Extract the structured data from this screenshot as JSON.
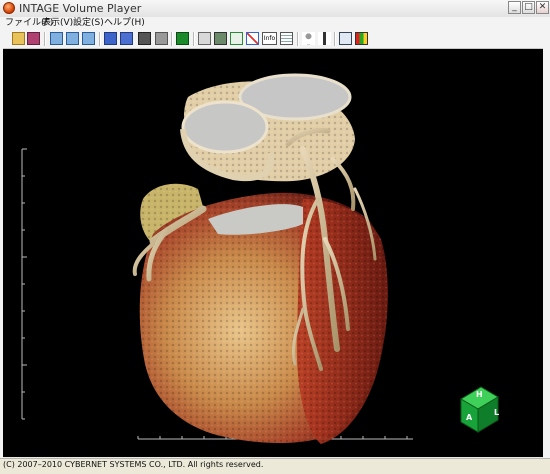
{
  "window": {
    "title": "INTAGE Volume Player"
  },
  "menu": {
    "items": [
      "ファイル(F)",
      "表示(V)",
      "設定(S)",
      "ヘルプ(H)"
    ]
  },
  "toolbar": {
    "icons": [
      "open-folder-icon",
      "save-image-icon",
      "single-view-icon",
      "dual-view-icon",
      "quad-view-icon",
      "cube-front-icon",
      "cube-side-icon",
      "cube-shaded-icon",
      "cube-gray-icon",
      "green-square-icon",
      "ruler-icon",
      "clip-box-icon",
      "wire-cube-icon",
      "axes-icon",
      "info-icon",
      "list-icon",
      "person-icon",
      "tower-icon",
      "window-icon",
      "color-palette-icon"
    ],
    "info_label": "Info"
  },
  "orientation_cube": {
    "top": "H",
    "front": "A",
    "side": "L"
  },
  "status": {
    "copyright": "(C) 2007–2010 CYBERNET SYSTEMS CO., LTD. All rights reserved."
  },
  "colors": {
    "viewport_bg": "#000000",
    "cube_green": "#17a33a"
  }
}
